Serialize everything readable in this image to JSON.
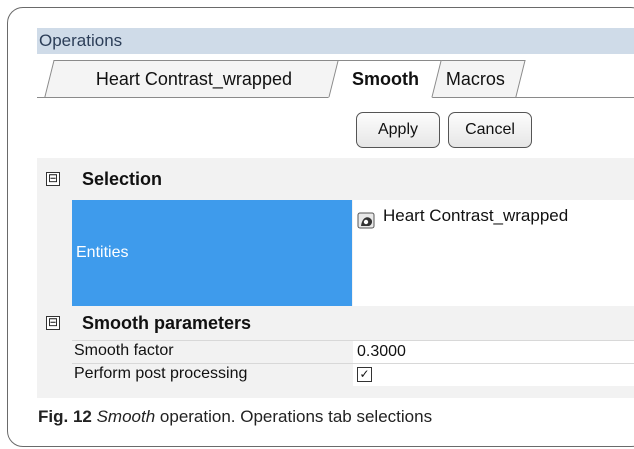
{
  "panel": {
    "title": "Operations"
  },
  "tabs": [
    {
      "label": "Heart Contrast_wrapped",
      "active": false
    },
    {
      "label": "Smooth",
      "active": true
    },
    {
      "label": "Macros",
      "active": false
    }
  ],
  "buttons": {
    "apply": "Apply",
    "cancel": "Cancel"
  },
  "sections": {
    "selection": {
      "toggle": "⊟",
      "title": "Selection",
      "entities_label": "Entities",
      "entities_value": "Heart Contrast_wrapped",
      "entity_icon": "mesh-object-icon"
    },
    "smooth": {
      "toggle": "⊟",
      "title": "Smooth parameters",
      "rows": [
        {
          "name": "Smooth factor",
          "value": "0.3000"
        },
        {
          "name": "Perform post processing",
          "value": "✓",
          "checked": true
        }
      ]
    }
  },
  "caption": {
    "fig": "Fig. 12",
    "emph": "Smooth",
    "text": " operation. Operations tab selections"
  },
  "colors": {
    "header_bg": "#cfdbe8",
    "selected_cell": "#3e9bec",
    "grid_bg": "#f2f2f2"
  }
}
